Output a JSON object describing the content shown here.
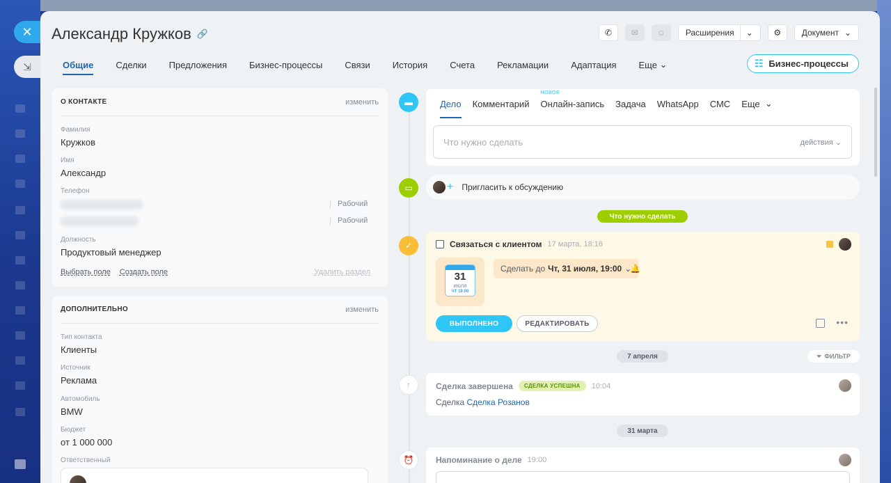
{
  "header": {
    "title": "Александр Кружков",
    "extensions_label": "Расширения",
    "document_label": "Документ"
  },
  "tabs": [
    {
      "label": "Общие",
      "active": true
    },
    {
      "label": "Сделки"
    },
    {
      "label": "Предложения"
    },
    {
      "label": "Бизнес-процессы"
    },
    {
      "label": "Связи"
    },
    {
      "label": "История"
    },
    {
      "label": "Счета"
    },
    {
      "label": "Рекламации"
    },
    {
      "label": "Адаптация"
    },
    {
      "label": "Еще"
    }
  ],
  "bp_button": "Бизнес-процессы",
  "contact_card": {
    "title": "О КОНТАКТЕ",
    "edit": "изменить",
    "last_name_label": "Фамилия",
    "last_name": "Кружков",
    "first_name_label": "Имя",
    "first_name": "Александр",
    "phone_label": "Телефон",
    "phone_type_1": "Рабочий",
    "phone_type_2": "Рабочий",
    "position_label": "Должность",
    "position": "Продуктовый менеджер",
    "select_field": "Выбрать поле",
    "create_field": "Создать поле",
    "delete_section": "Удалить раздел"
  },
  "extra_card": {
    "title": "ДОПОЛНИТЕЛЬНО",
    "edit": "изменить",
    "contact_type_label": "Тип контакта",
    "contact_type": "Клиенты",
    "source_label": "Источник",
    "source": "Реклама",
    "car_label": "Автомобиль",
    "car": "BMW",
    "budget_label": "Бюджет",
    "budget": "от 1 000 000",
    "responsible_label": "Ответственный"
  },
  "composer": {
    "tabs": [
      "Дело",
      "Комментарий",
      "Онлайн-запись",
      "Задача",
      "WhatsApp",
      "СМС",
      "Еще"
    ],
    "new_tag": "НОВОЕ",
    "placeholder": "Что нужно сделать",
    "actions": "действия"
  },
  "invite": "Пригласить к обсуждению",
  "todo_pill": "Что нужно сделать",
  "task": {
    "title": "Связаться с клиентом",
    "created": "17 марта, 18:16",
    "cal_day": "31",
    "cal_month": "июля",
    "cal_time": "ЧТ 19:00",
    "deadline_label": "Сделать до",
    "deadline_value": "Чт, 31 июля, 19:00",
    "done_button": "ВЫПОЛНЕНО",
    "edit_button": "РЕДАКТИРОВАТЬ"
  },
  "date_1": "7 апреля",
  "filter": "ФИЛЬТР",
  "event_deal": {
    "title": "Сделка завершена",
    "badge": "СДЕЛКА УСПЕШНА",
    "time": "10:04",
    "body_prefix": "Сделка",
    "body_link": "Сделка Розанов"
  },
  "date_2": "31 марта",
  "event_reminder": {
    "title": "Напоминание о деле",
    "time": "19:00"
  },
  "colors": {
    "accent": "#2fc6f6",
    "link": "#2067b0",
    "green": "#9dcf00",
    "task_bg": "#fef9e6"
  }
}
